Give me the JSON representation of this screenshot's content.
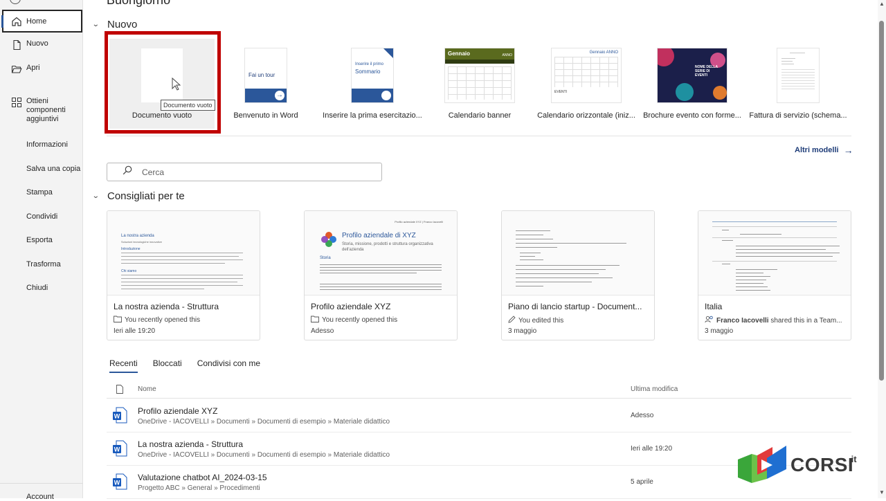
{
  "page": {
    "title": "Buongiorno"
  },
  "sidebar": {
    "items": [
      {
        "label": "Home",
        "icon": "home-icon",
        "active": true
      },
      {
        "label": "Nuovo",
        "icon": "new-document-icon"
      },
      {
        "label": "Apri",
        "icon": "folder-open-icon"
      },
      {
        "label": "Ottieni componenti aggiuntivi",
        "icon": "grid-addins-icon"
      }
    ],
    "plain_items": [
      "Informazioni",
      "Salva una copia",
      "Stampa",
      "Condividi",
      "Esporta",
      "Trasforma",
      "Chiudi"
    ],
    "bottom_item": "Account"
  },
  "new_section": {
    "title": "Nuovo",
    "templates": [
      {
        "label": "Documento vuoto",
        "tooltip": "Documento vuoto"
      },
      {
        "label": "Benvenuto in Word",
        "thumb_text": "Fai un tour"
      },
      {
        "label": "Inserire la prima esercitazio...",
        "thumb_text_1": "Inserire il primo",
        "thumb_text_2": "Sommario"
      },
      {
        "label": "Calendario banner",
        "thumb_text": "Gennaio",
        "thumb_text_2": "ANNO"
      },
      {
        "label": "Calendario orizzontale (iniz...",
        "thumb_text": "Gennaio ANNO",
        "thumb_text_2": "EVENTI"
      },
      {
        "label": "Brochure evento con forme...",
        "thumb_text": "NOME DELLA SERIE DI EVENTI"
      },
      {
        "label": "Fattura di servizio (schema..."
      }
    ],
    "more_link": "Altri modelli"
  },
  "search": {
    "placeholder": "Cerca"
  },
  "recommended": {
    "title": "Consigliati per te",
    "cards": [
      {
        "title": "La nostra azienda - Struttura",
        "activity": "You recently opened this",
        "date": "Ieri alle 19:20",
        "activity_icon": "folder-icon",
        "preview_heading": "La nostra azienda",
        "preview_sub": "Soluzioni tecnologiche innovative",
        "preview_section": "Introduzione",
        "preview_section_2": "Chi siamo"
      },
      {
        "title": "Profilo aziendale XYZ",
        "activity": "You recently opened this",
        "date": "Adesso",
        "activity_icon": "folder-icon",
        "preview_heading": "Profilo aziendale di XYZ",
        "preview_sub": "Storia, missione, prodotti e struttura organizzativa dell'azienda",
        "preview_section": "Storia",
        "preview_top": "Profilo aziendale XYZ | Franco Iacovelli"
      },
      {
        "title": "Piano di lancio startup - Document...",
        "activity": "You edited this",
        "date": "3 maggio",
        "activity_icon": "pencil-icon"
      },
      {
        "title": "Italia",
        "activity_bold": "Franco Iacovelli",
        "activity": " shared this in a Team...",
        "date": "3 maggio",
        "activity_icon": "shared-people-icon"
      }
    ]
  },
  "files": {
    "tabs": [
      "Recenti",
      "Bloccati",
      "Condivisi con me"
    ],
    "active_tab": "Recenti",
    "columns": {
      "name": "Nome",
      "modified": "Ultima modifica"
    },
    "rows": [
      {
        "name": "Profilo aziendale XYZ",
        "path": "OneDrive - IACOVELLI » Documenti » Documenti di esempio » Materiale didattico",
        "modified": "Adesso"
      },
      {
        "name": "La nostra azienda - Struttura",
        "path": "OneDrive - IACOVELLI » Documenti » Documenti di esempio » Materiale didattico",
        "modified": "Ieri alle 19:20"
      },
      {
        "name": "Valutazione chatbot AI_2024-03-15",
        "path": "Progetto ABC » General » Procedimenti",
        "modified": "5 aprile"
      }
    ]
  },
  "watermark": {
    "text": "CORSI",
    "suffix": ".it"
  },
  "colors": {
    "accent": "#2b579a",
    "highlight": "#c00000",
    "word_blue": "#185abd"
  }
}
